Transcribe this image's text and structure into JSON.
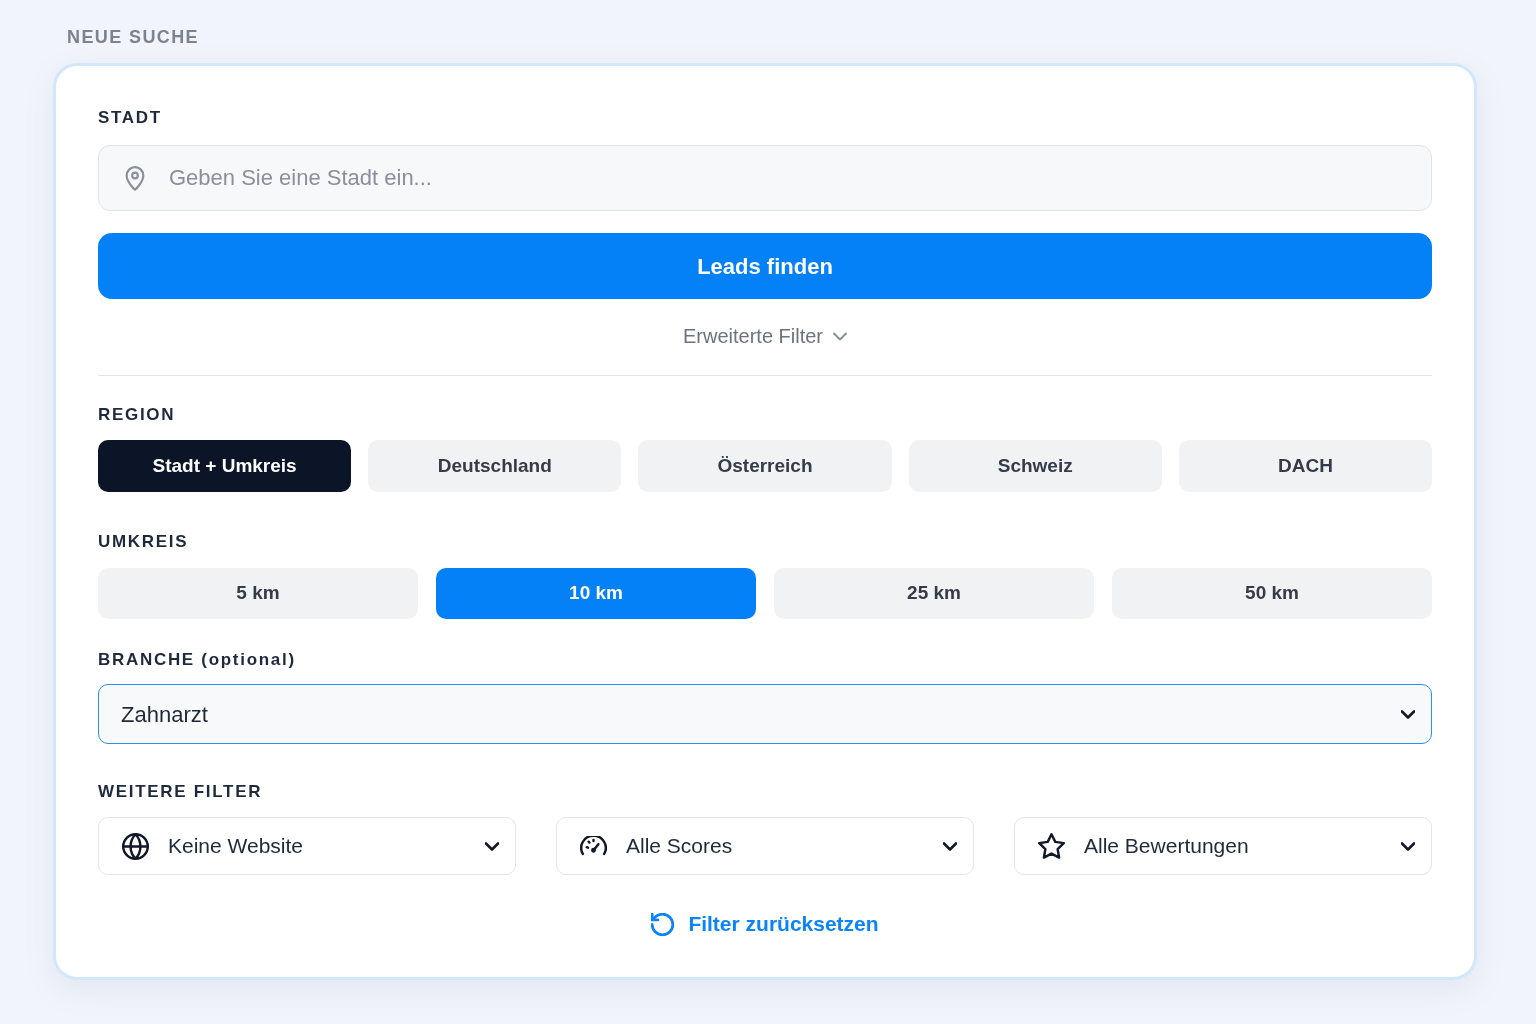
{
  "heading": "NEUE SUCHE",
  "city": {
    "label": "STADT",
    "placeholder": "Geben Sie eine Stadt ein..."
  },
  "search_button": "Leads finden",
  "advanced_toggle": "Erweiterte Filter",
  "region": {
    "label": "REGION",
    "options": [
      {
        "label": "Stadt + Umkreis",
        "selected": true
      },
      {
        "label": "Deutschland",
        "selected": false
      },
      {
        "label": "Österreich",
        "selected": false
      },
      {
        "label": "Schweiz",
        "selected": false
      },
      {
        "label": "DACH",
        "selected": false
      }
    ]
  },
  "radius": {
    "label": "UMKREIS",
    "options": [
      {
        "label": "5 km",
        "selected": false
      },
      {
        "label": "10 km",
        "selected": true
      },
      {
        "label": "25 km",
        "selected": false
      },
      {
        "label": "50 km",
        "selected": false
      }
    ]
  },
  "industry": {
    "label": "BRANCHE (optional)",
    "value": "Zahnarzt",
    "focused": true
  },
  "more_filters": {
    "label": "WEITERE FILTER",
    "selects": [
      {
        "kind": "website",
        "value": "Keine Website"
      },
      {
        "kind": "score",
        "value": "Alle Scores"
      },
      {
        "kind": "rating",
        "value": "Alle Bewertungen"
      }
    ]
  },
  "reset_link": "Filter zurücksetzen"
}
